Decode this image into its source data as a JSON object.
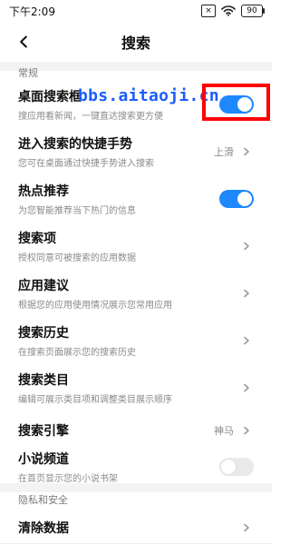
{
  "status_bar": {
    "time": "下午2:09",
    "battery": "90"
  },
  "header": {
    "title": "搜索"
  },
  "sections": {
    "general_label": "常规",
    "privacy_label": "隐私和安全"
  },
  "watermark_text": "bbs.aitaoji.cn",
  "rows": [
    {
      "title": "桌面搜索框",
      "subtitle": "搜应用看新闻，一键直达搜索更方便",
      "toggle": true
    },
    {
      "title": "进入搜索的快捷手势",
      "subtitle": "您可在桌面通过快捷手势进入搜索",
      "value": "上滑"
    },
    {
      "title": "热点推荐",
      "subtitle": "为您智能推荐当下热门的信息",
      "toggle": true
    },
    {
      "title": "搜索项",
      "subtitle": "授权同意可被搜索的应用数据"
    },
    {
      "title": "应用建议",
      "subtitle": "根据您的应用使用情况展示您常用应用"
    },
    {
      "title": "搜索历史",
      "subtitle": "在搜索页面展示您的搜索历史"
    },
    {
      "title": "搜索类目",
      "subtitle": "编辑可展示类目项和调整类目展示顺序"
    },
    {
      "title": "搜索引擎",
      "subtitle": "",
      "value": "神马"
    },
    {
      "title": "小说频道",
      "subtitle": "在首页显示您的小说书架",
      "toggle": false
    },
    {
      "title": "清除数据",
      "subtitle": ""
    }
  ],
  "colors": {
    "accent": "#1e88ff",
    "highlight": "#ff0000",
    "watermark": "#1b5cff"
  }
}
